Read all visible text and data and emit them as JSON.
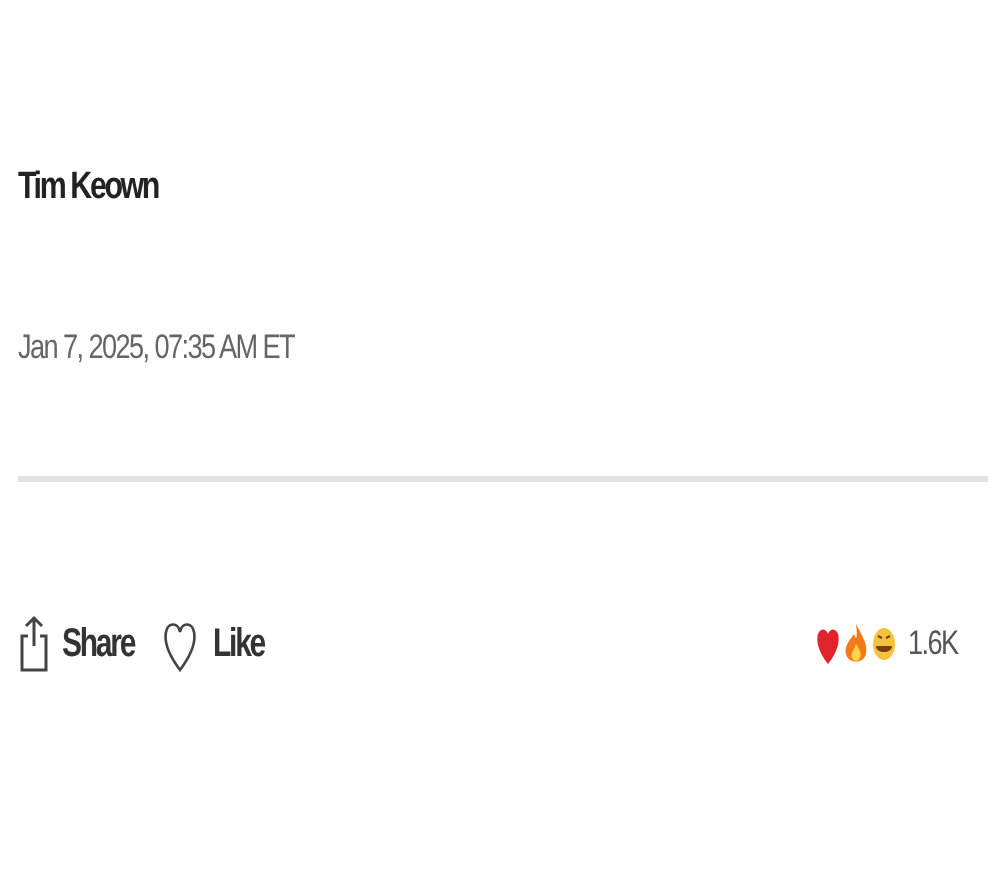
{
  "author": "Tim Keown",
  "timestamp": "Jan 7, 2025, 07:35 AM ET",
  "actions": [
    {
      "kind": "share",
      "label": "Share"
    },
    {
      "kind": "like",
      "label": "Like"
    }
  ],
  "reactions": {
    "count": "1.6K"
  }
}
